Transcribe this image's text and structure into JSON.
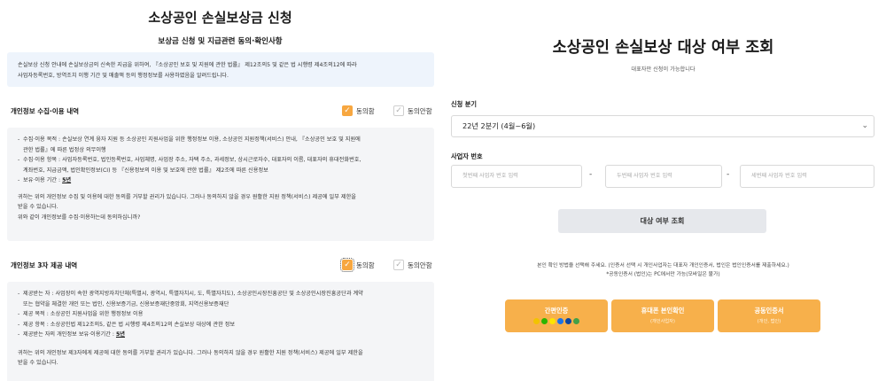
{
  "left": {
    "title": "소상공인 손실보상금 신청",
    "subtitle": "보상금 신청 및 지급관련 동의·확인사항",
    "intro_lines": [
      "손실보상 신청 안내에 손실보상금의 신속한 지급을 위하여, 『소상공인 보호 및 지원에 관한 법률』 제12조의5 및 같은 법 시행령 제4조의12에 따라",
      "사업자등록번호, 방역조치 이행 기간 및 매출액 등의 행정정보를 사용하였음을 알려드립니다."
    ],
    "section1": {
      "label": "개인정보 수집·이용 내역",
      "agree_label": "동의함",
      "disagree_label": "동의안함",
      "items": [
        "수집·이용 목적 : 손실보상 연계 융자 지원 등 소상공인 지원사업을 위한 행정정보 이용, 소상공인 지원정책(서비스) 안내, 『소상공인 보호 및 지원에",
        "관한 법률』에 따른 법정상 의무이행",
        "수집·이용 항목 : 사업자등록번호, 법인등록번호, 사업체명, 사업장 주소, 자택 주소, 과세정보, 상시근로자수, 대표자의 이름, 대표자의 휴대전화번호,",
        "계좌번호, 지급금액, 법인확인정보(CI) 등 『신용정보의 이용 및 보호에 관한 법률』 제2조에 따른 신용정보",
        "보유·이용 기간 : ",
        "5년"
      ],
      "paras": [
        "귀하는 위의 개인정보 수집 및 이용에 대한 동의를 거부할 권리가 있습니다. 그러나 동의하지 않을 경우 원활한 지원 정책(서비스) 제공에 일부 제한을",
        "받을 수 있습니다.",
        "위와 같이 개인정보를 수집·이용하는데 동의하십니까?"
      ]
    },
    "section2": {
      "label": "개인정보 3자 제공 내역",
      "agree_label": "동의함",
      "disagree_label": "동의안함",
      "items": [
        "제공받는 자 : 사업장이 속한 광역지방자치단체(특별시, 광역시, 특별자치시, 도, 특별자치도), 소상공인시장진흥공단 및 소상공인시장진흥공단과 계약",
        "또는 협약을 체결한 개인 또는 법인, 신용보증기금, 신용보증재단중앙회, 지역신용보증재단",
        "제공 목적 : 소상공인 지원사업을 위한 행정정보 이용",
        "제공 항목 : 소상공인법 제12조의5, 같은 법 시행령 제4조의12의 손실보상 대상에 관한 정보",
        "제공받는 자의 개인정보 보유·이용기간 : ",
        "5년"
      ],
      "paras": [
        "귀하는 위의 개인정보 제3자에게 제공에 대한 동의를 거부할 권리가 있습니다. 그러나 동의하지 않을 경우 원활한 지원 정책(서비스) 제공에 일부 제한을",
        "받을 수 있습니다."
      ]
    }
  },
  "right": {
    "title": "소상공인 손실보상 대상 여부 조회",
    "subtitle": "대표자만 신청이 가능합니다",
    "quarter_label": "신청 분기",
    "quarter_value": "22년 2분기 (4월~6월)",
    "biz_label": "사업자 번호",
    "biz_placeholders": [
      "첫번째 사업자 번호 입력",
      "두번째 사업자 번호 입력",
      "세번째 사업자 번호 입력"
    ],
    "dash": "-",
    "search_button": "대상 여부 조회",
    "auth_notice": [
      "본인 확인 방법을 선택해 주세요. (인증서 선택 시 개인사업자는 대표자 개인인증서, 법인은 법인인증서를 제출하세요.)",
      "*공동인증서 (법인)는 PC에서만 가능(모바일은 불가)"
    ],
    "auth_buttons": [
      {
        "main": "간편인증",
        "sub": ""
      },
      {
        "main": "휴대폰 본인확인",
        "sub": "(개인사업자)"
      },
      {
        "main": "공동인증서",
        "sub": "(개인, 법인)"
      }
    ],
    "icon_colors": [
      "#f2c300",
      "#2db400",
      "#fee500",
      "#1a73e8",
      "#0d47a1",
      "#43a047"
    ],
    "accent": "#f7b04b"
  }
}
